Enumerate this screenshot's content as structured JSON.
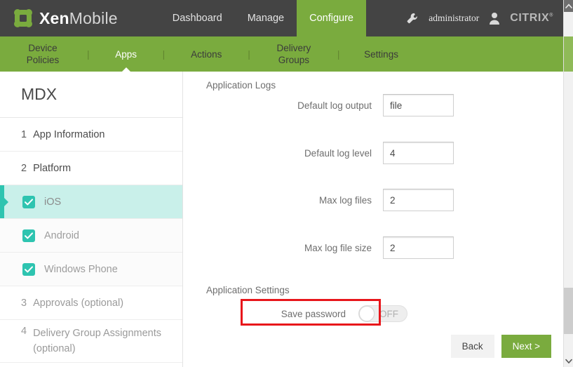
{
  "header": {
    "brand_bold": "Xen",
    "brand_light": "Mobile",
    "logo_icon": "xenmobile-node-logo",
    "nav": [
      {
        "label": "Dashboard",
        "active": false
      },
      {
        "label": "Manage",
        "active": false
      },
      {
        "label": "Configure",
        "active": true
      }
    ],
    "wrench_icon": "wrench-icon",
    "user": "administrator",
    "person_icon": "person-icon",
    "vendor": "CITRIX",
    "vendor_mark": "®",
    "accent_green": "#7aab3e",
    "bar_dark": "#444444"
  },
  "subnav": {
    "separator": "|",
    "items": [
      {
        "label": "Device\nPolicies",
        "active": false
      },
      {
        "label": "Apps",
        "active": true
      },
      {
        "label": "Actions",
        "active": false
      },
      {
        "label": "Delivery\nGroups",
        "active": false
      },
      {
        "label": "Settings",
        "active": false
      }
    ]
  },
  "sidebar": {
    "title": "MDX",
    "items": [
      {
        "num": "1",
        "label": "App Information",
        "type": "step",
        "muted": false
      },
      {
        "num": "2",
        "label": "Platform",
        "type": "step",
        "muted": false
      },
      {
        "num": "",
        "label": "iOS",
        "type": "platform",
        "checked": true,
        "selected": true
      },
      {
        "num": "",
        "label": "Android",
        "type": "platform",
        "checked": true,
        "selected": false
      },
      {
        "num": "",
        "label": "Windows Phone",
        "type": "platform",
        "checked": true,
        "selected": false
      },
      {
        "num": "3",
        "label": "Approvals (optional)",
        "type": "step",
        "muted": true
      },
      {
        "num": "4",
        "label": "Delivery Group Assignments (optional)",
        "type": "step",
        "muted": true
      }
    ],
    "selected_color": "#c9f0ea",
    "accent_color": "#2ec4b0"
  },
  "main": {
    "logs_section_title": "Application Logs",
    "fields": [
      {
        "label": "Default log output",
        "value": "file"
      },
      {
        "label": "Default log level",
        "value": "4"
      },
      {
        "label": "Max log files",
        "value": "2"
      },
      {
        "label": "Max log file size",
        "value": "2"
      }
    ],
    "settings_section_title": "Application Settings",
    "toggle": {
      "label": "Save password",
      "state": "OFF",
      "on": false,
      "highlight_color": "#e8161b"
    }
  },
  "footer": {
    "back_label": "Back",
    "next_label": "Next >"
  },
  "scrollbar": {
    "up_icon": "chevron-up-icon",
    "down_icon": "chevron-down-icon"
  }
}
